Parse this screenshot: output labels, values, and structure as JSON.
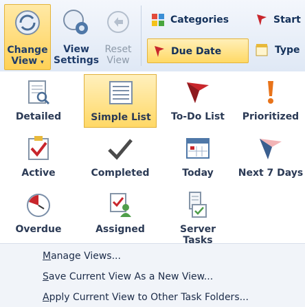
{
  "ribbon": {
    "change_view": {
      "line1": "Change",
      "line2": "View",
      "arrow": "▾"
    },
    "view_settings": {
      "line1": "View",
      "line2": "Settings"
    },
    "reset_view": {
      "line1": "Reset",
      "line2": "View"
    },
    "categories": "Categories",
    "start_date": "Start I",
    "due_date": "Due Date",
    "type": "Type"
  },
  "gallery": {
    "items": [
      {
        "label": "Detailed",
        "icon": "detailed-view-icon"
      },
      {
        "label": "Simple List",
        "icon": "simple-list-icon",
        "selected": true
      },
      {
        "label": "To-Do List",
        "icon": "todo-flag-icon"
      },
      {
        "label": "Prioritized",
        "icon": "prioritized-icon"
      },
      {
        "label": "Active",
        "icon": "active-check-icon"
      },
      {
        "label": "Completed",
        "icon": "completed-check-icon"
      },
      {
        "label": "Today",
        "icon": "today-calendar-icon"
      },
      {
        "label": "Next 7 Days",
        "icon": "next7-flag-icon"
      },
      {
        "label": "Overdue",
        "icon": "overdue-clock-icon"
      },
      {
        "label": "Assigned",
        "icon": "assigned-icon"
      },
      {
        "label": "Server Tasks",
        "icon": "server-tasks-icon"
      }
    ]
  },
  "menu": {
    "manage_key": "M",
    "manage_rest": "anage Views...",
    "save_key": "S",
    "save_rest": "ave Current View As a New View...",
    "apply_key": "A",
    "apply_rest": "pply Current View to Other Task Folders..."
  },
  "colors": {
    "accent": "#ffd965",
    "flag_red": "#c8262c",
    "check_gray": "#4b4b4b"
  }
}
